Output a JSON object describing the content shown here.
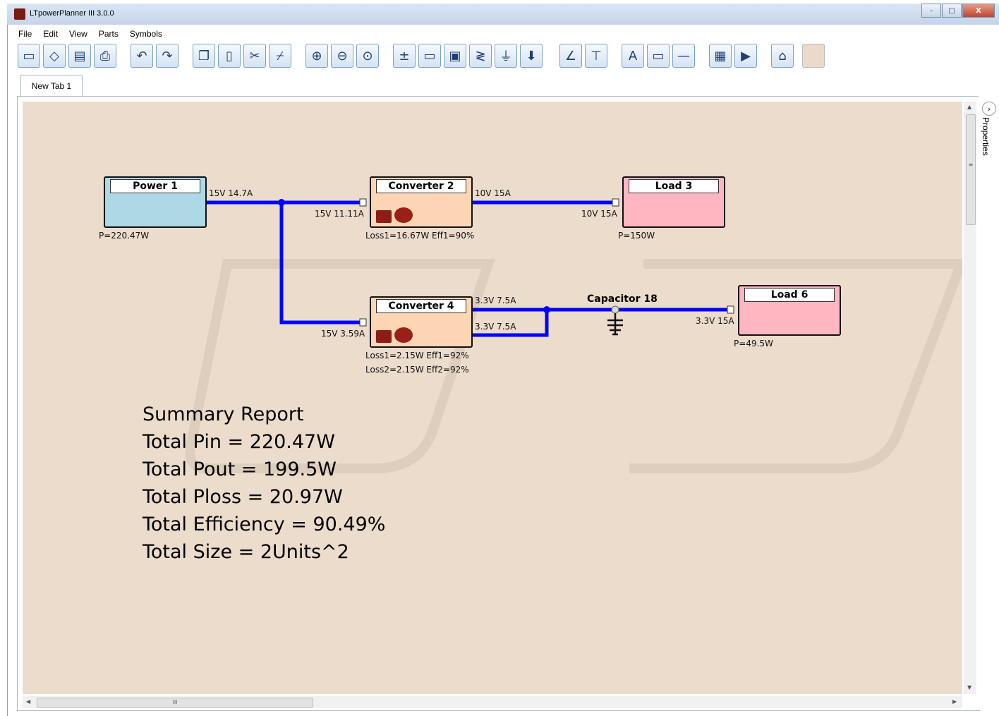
{
  "window": {
    "title": "LTpowerPlanner III 3.0.0",
    "minimize": "–",
    "maximize": "□",
    "close": "X"
  },
  "menu": [
    "File",
    "Edit",
    "View",
    "Parts",
    "Symbols"
  ],
  "toolbar": [
    {
      "name": "new-icon",
      "glyph": "▭"
    },
    {
      "name": "open-icon",
      "glyph": "◇"
    },
    {
      "name": "save-icon",
      "glyph": "▤"
    },
    {
      "name": "print-icon",
      "glyph": "⎙"
    },
    {
      "name": "undo-icon",
      "glyph": "↶"
    },
    {
      "name": "redo-icon",
      "glyph": "↷"
    },
    {
      "name": "copy-icon",
      "glyph": "❐"
    },
    {
      "name": "paste-icon",
      "glyph": "▯"
    },
    {
      "name": "cut-icon",
      "glyph": "✂"
    },
    {
      "name": "broom-icon",
      "glyph": "⌿"
    },
    {
      "name": "zoom-in-icon",
      "glyph": "⊕"
    },
    {
      "name": "zoom-out-icon",
      "glyph": "⊖"
    },
    {
      "name": "zoom-fit-icon",
      "glyph": "⊙"
    },
    {
      "name": "power-source-icon",
      "glyph": "±"
    },
    {
      "name": "converter-icon",
      "glyph": "▭"
    },
    {
      "name": "ldo-icon",
      "glyph": "▣"
    },
    {
      "name": "resistor-icon",
      "glyph": "≷"
    },
    {
      "name": "capacitor-icon",
      "glyph": "⏚"
    },
    {
      "name": "load-icon",
      "glyph": "⬇"
    },
    {
      "name": "line-icon",
      "glyph": "∠"
    },
    {
      "name": "connector-icon",
      "glyph": "⊤"
    },
    {
      "name": "text-icon",
      "glyph": "A"
    },
    {
      "name": "rectangle-icon",
      "glyph": "▭"
    },
    {
      "name": "hline-icon",
      "glyph": "—"
    },
    {
      "name": "calculator-icon",
      "glyph": "▦"
    },
    {
      "name": "run-icon",
      "glyph": "▶"
    },
    {
      "name": "lt-logo-icon",
      "glyph": "⌂"
    },
    {
      "name": "color-swatch",
      "glyph": ""
    }
  ],
  "tab": {
    "label": "New Tab 1"
  },
  "properties": {
    "label": "Properties",
    "toggle": "›"
  },
  "scroll": {
    "h_thumb_grip": "III",
    "v_thumb_grip": "≡"
  },
  "diagram": {
    "power1": {
      "name": "Power 1",
      "out_label": "15V 14.7A",
      "power": "P=220.47W"
    },
    "converter2": {
      "name": "Converter 2",
      "in_label": "15V 11.11A",
      "out_label": "10V 15A",
      "loss": "Loss1=16.67W Eff1=90%"
    },
    "load3": {
      "name": "Load 3",
      "in_label": "10V 15A",
      "power": "P=150W"
    },
    "converter4": {
      "name": "Converter 4",
      "in_label": "15V 3.59A",
      "out1_label": "3.3V 7.5A",
      "out2_label": "3.3V 7.5A",
      "loss1": "Loss1=2.15W  Eff1=92%",
      "loss2": "Loss2=2.15W  Eff2=92%"
    },
    "capacitor18": {
      "name": "Capacitor 18"
    },
    "load6": {
      "name": "Load 6",
      "in_label": "3.3V 15A",
      "power": "P=49.5W"
    }
  },
  "summary": {
    "title": "Summary Report",
    "pin": "Total Pin = 220.47W",
    "pout": "Total Pout = 199.5W",
    "ploss": "Total Ploss = 20.97W",
    "efficiency": "Total Efficiency = 90.49%",
    "size": "Total Size = 2Units^2"
  },
  "colors": {
    "canvas": "#ecdccc",
    "wire": "#0000ff",
    "power_block": "#add8e6",
    "converter_block": "#fcd6b4",
    "load_block": "#ffb6c1"
  }
}
